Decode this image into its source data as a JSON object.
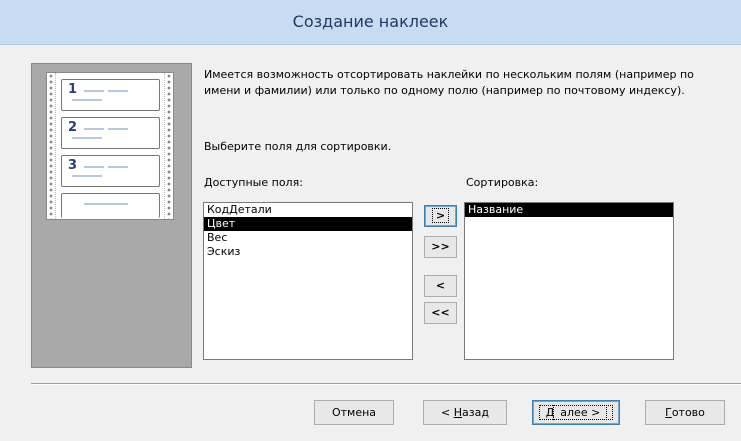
{
  "window": {
    "title": "Создание наклеек"
  },
  "illustration": {
    "labels": [
      "1",
      "2",
      "3"
    ]
  },
  "intro_text": "Имеется возможность отсортировать наклейки по нескольким полям (например по имени и фамилии) или только по одному полю (например по почтовому индексу).",
  "prompt": "Выберите поля для сортировки.",
  "available": {
    "label": "Доступные поля:",
    "items": [
      {
        "text": "КодДетали",
        "selected": false
      },
      {
        "text": "Цвет",
        "selected": true
      },
      {
        "text": "Вес",
        "selected": false
      },
      {
        "text": "Эскиз",
        "selected": false
      }
    ]
  },
  "sorting": {
    "label": "Сортировка:",
    "items": [
      {
        "text": "Название",
        "selected": true
      }
    ]
  },
  "move_buttons": {
    "add_one": ">",
    "add_all": ">>",
    "remove_one": "<",
    "remove_all": "<<"
  },
  "footer": {
    "cancel": "Отмена",
    "back_prefix": "< ",
    "back_mnemonic": "Н",
    "back_rest": "азад",
    "next_mnemonic": "Д",
    "next_rest": "алее >",
    "finish_mnemonic": "Г",
    "finish_rest": "отово"
  }
}
